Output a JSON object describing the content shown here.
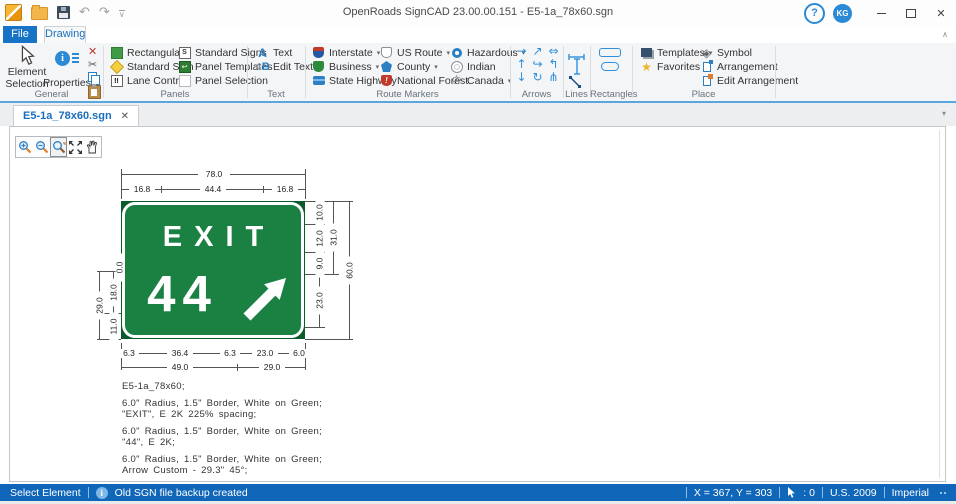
{
  "window": {
    "title": "OpenRoads SignCAD 23.00.00.151 - E5-1a_78x60.sgn",
    "help": "?",
    "user": "KG"
  },
  "glyphs": {
    "caret": "▾",
    "close": "✕",
    "chevron_up": "∧",
    "doc_caret": "▾",
    "undo": "↶",
    "redo": "↷",
    "qat_more": "∨",
    "red_x": "✕",
    "scissors": "✂",
    "info": "i",
    "exclaim": "!",
    "s": "S",
    "lane": "‼",
    "panel_arrow": "↩",
    "text_a": "A",
    "edit_a": "A",
    "edit_b": "B",
    "star": "★",
    "symbol": "◈",
    "crown": "♔",
    "zoom_plus": "+",
    "zoom_minus": "−"
  },
  "ribbon": {
    "tabs": [
      {
        "label": "File"
      },
      {
        "label": "Drawing"
      }
    ],
    "general": {
      "label": "General",
      "element_selection": "Element Selection",
      "properties": "Properties"
    },
    "panels": {
      "label": "Panels",
      "items": [
        "Rectangular",
        "Standard Sign",
        "Lane Control",
        "Standard Signs",
        "Panel Templates",
        "Panel Selection"
      ]
    },
    "text": {
      "label": "Text",
      "text": "Text",
      "edit_text": "Edit Text"
    },
    "route_markers": {
      "label": "Route Markers",
      "items": [
        "Interstate",
        "Business",
        "State Highway",
        "US Route",
        "County",
        "National Forest",
        "Hazardous",
        "Indian",
        "Canada"
      ]
    },
    "arrows": {
      "label": "Arrows",
      "icons": [
        "→",
        "↗",
        "⇔",
        "↑",
        "↪",
        "↰",
        "↓",
        "↻",
        "⋔"
      ]
    },
    "lines": {
      "label": "Lines"
    },
    "rectangles": {
      "label": "Rectangles"
    },
    "place": {
      "label": "Place",
      "templates": "Templates",
      "favorites": "Favorites",
      "symbol": "Symbol",
      "arrangement": "Arrangement",
      "edit_arrangement": "Edit Arrangement"
    }
  },
  "doc_tab": {
    "label": "E5-1a_78x60.sgn"
  },
  "sign": {
    "exit": "EXIT",
    "number": "44"
  },
  "dims": {
    "top_total": "78.0",
    "top_left": "16.8",
    "top_mid": "44.4",
    "top_right": "16.8",
    "left_zero": "0.0",
    "left_18": "18.0",
    "left_29": "29.0",
    "left_11": "11.0",
    "right_10": "10.0",
    "right_12": "12.0",
    "right_9": "9.0",
    "right_23": "23.0",
    "right_31": "31.0",
    "right_60": "60.0",
    "bot_63a": "6.3",
    "bot_364": "36.4",
    "bot_63b": "6.3",
    "bot_230": "23.0",
    "bot_60": "6.0",
    "bot_490": "49.0",
    "bot_290": "29.0"
  },
  "notes": [
    "E5-1a_78x60;",
    "6.0\" Radius, 1.5\" Border, White on Green;",
    "\"EXIT\",  E 2K 225% spacing;",
    "6.0\" Radius, 1.5\" Border, White on Green;",
    "\"44\",  E 2K;",
    "6.0\" Radius, 1.5\" Border, White on Green;",
    "Arrow Custom - 29.3\" 45°;"
  ],
  "status": {
    "mode": "Select Element",
    "message": "Old SGN file backup created",
    "coords": "X = 367, Y = 303",
    "counter": ": 0",
    "standard": "U.S. 2009",
    "units": "Imperial"
  },
  "colors": {
    "accent": "#1773c6",
    "sign_green": "#1a8142",
    "sign_green_dark": "#0b5a2a",
    "status_blue": "#1066b8"
  }
}
